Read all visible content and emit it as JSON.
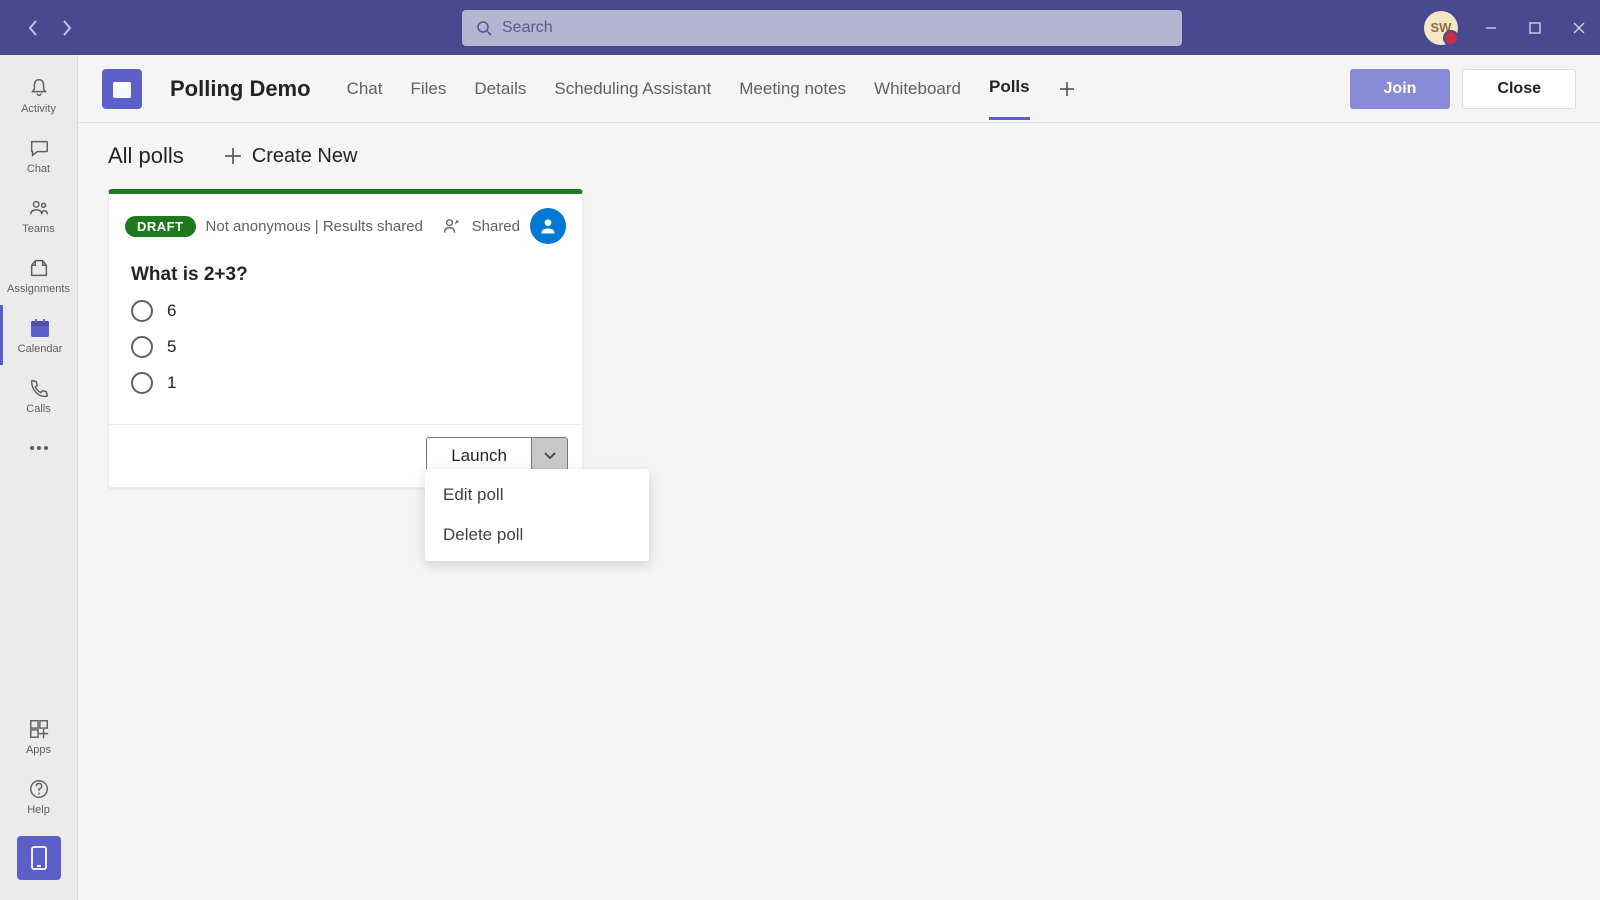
{
  "titlebar": {
    "search_placeholder": "Search",
    "avatar_initials": "SW"
  },
  "rail": {
    "items": [
      {
        "label": "Activity"
      },
      {
        "label": "Chat"
      },
      {
        "label": "Teams"
      },
      {
        "label": "Assignments"
      },
      {
        "label": "Calendar"
      },
      {
        "label": "Calls"
      }
    ],
    "apps_label": "Apps",
    "help_label": "Help"
  },
  "tabbar": {
    "meeting_title": "Polling Demo",
    "tabs": [
      {
        "label": "Chat"
      },
      {
        "label": "Files"
      },
      {
        "label": "Details"
      },
      {
        "label": "Scheduling Assistant"
      },
      {
        "label": "Meeting notes"
      },
      {
        "label": "Whiteboard"
      },
      {
        "label": "Polls"
      }
    ],
    "join_label": "Join",
    "close_label": "Close"
  },
  "polls": {
    "header_title": "All polls",
    "create_new_label": "Create New",
    "card": {
      "draft_label": "DRAFT",
      "meta": "Not anonymous | Results shared",
      "shared_label": "Shared",
      "question": "What is 2+3?",
      "options": [
        "6",
        "5",
        "1"
      ],
      "launch_label": "Launch",
      "dropdown": {
        "edit": "Edit poll",
        "delete": "Delete poll"
      }
    }
  }
}
